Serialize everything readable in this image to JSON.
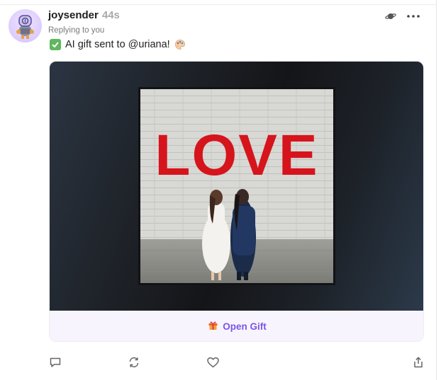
{
  "post": {
    "username": "joysender",
    "time": "44s",
    "reply_label": "Replying to you",
    "message": "AI gift sent to @uriana!",
    "icons": {
      "avatar": "robot-avatar",
      "status": "check-box-emoji",
      "trailing": "palette-emoji",
      "header_left": "channel-icon",
      "header_right": "more-icon"
    }
  },
  "card": {
    "image_text": "LOVE",
    "button_icon": "gift-icon",
    "button_label": "Open Gift",
    "accent": "#7c55e6",
    "footer_bg": "#f7f4fd"
  },
  "actions": {
    "items": [
      "reply-icon",
      "recast-icon",
      "like-icon",
      "share-icon"
    ]
  }
}
